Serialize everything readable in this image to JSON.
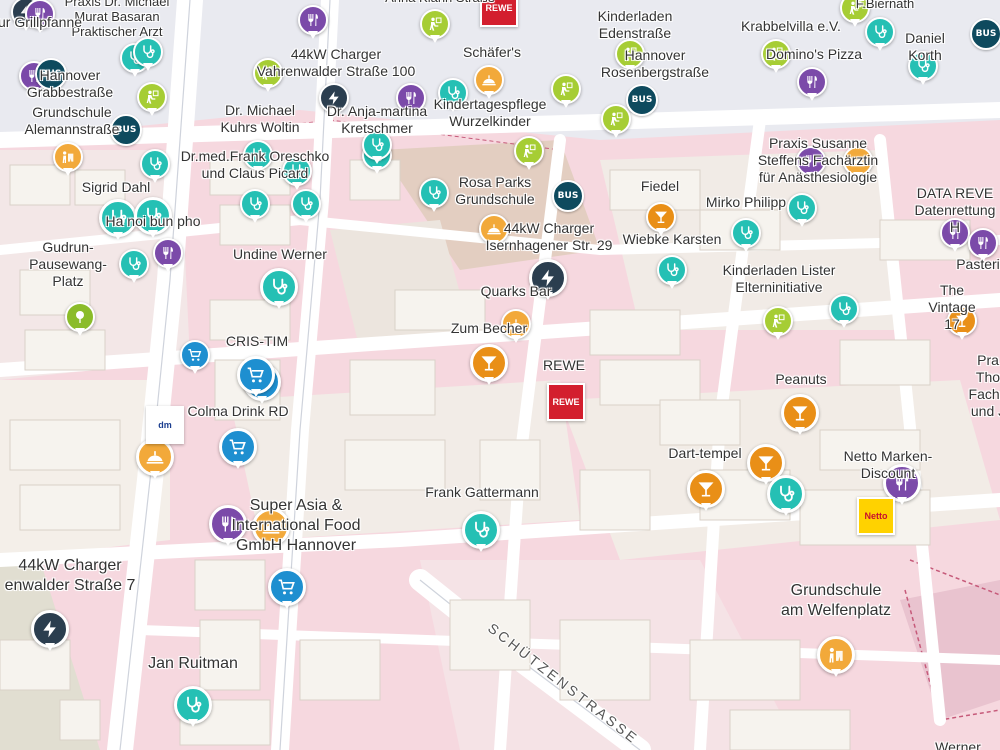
{
  "map": {
    "colors": {
      "health": "#25c0b4",
      "food": "#7b4aa9",
      "bar": "#e98f17",
      "charger": "#2b3e4f",
      "shop": "#1e8fd0",
      "school": "#a6cd34",
      "cafe": "#f2a93a",
      "bus": "#0e4a5e",
      "park": "#8bbc2a",
      "rewe": "#d31f2e",
      "netto": "#ffd200",
      "residential": "#f3c9d2",
      "building": "#f4f1ec"
    },
    "street": "SCHÜTZENSTRASSE",
    "labels": [
      "Praxis Dr. Michael\nMurat Basaran\nPraktischer Arzt",
      "Anna Klann Straße",
      "Kinderladen\nEdenstraße",
      "Krabbelvilla e.V.",
      "F.Biernath",
      "Daniel Korth",
      "ur Grillpfanne",
      "44kW Charger\nVahrenwalder Straße 100",
      "Schäfer's",
      "Hannover\nRosenbergstraße",
      "Domino's Pizza",
      "Hannover\nGrabbestraße",
      "Dr. Michael\nKuhrs Woltin",
      "Dr. Anja-martina\nKretschmer",
      "Kindertagespflege\nWurzelkinder",
      "Grundschule\nAlemannstraße",
      "Praxis Susanne\nSteffens Fachärztin\nfür Anästhesiologie",
      "Dr.med.Frank Oreschko\nund Claus Picard",
      "Rosa Parks\nGrundschule",
      "Fiedel",
      "DATA REVE\nDatenrettung H",
      "Sigrid Dahl",
      "Mirko Philipp",
      "Ha noi bun pho",
      "44kW Charger\nIsernhagener Str. 29",
      "Wiebke Karsten",
      "Pasteri",
      "Gudrun-\nPausewang-\nPlatz",
      "Undine Werner",
      "Kinderladen Lister\nElterninitiative",
      "Quarks Bar",
      "The Vintage 17",
      "Zum Becher",
      "CRIS-TIM",
      "REWE",
      "Pra\nTho\nFacha\nund J",
      "Colma Drink RD",
      "Peanuts",
      "Dart-tempel",
      "Netto Marken-\nDiscount",
      "Frank Gattermann",
      "Super Asia &\nInternational Food\nGmbH Hannover",
      "44kW Charger\nenwalder Straße 7",
      "Grundschule\nam Welfenplatz",
      "Jan Ruitman",
      "Werner w"
    ],
    "bus_label": "BUS",
    "dm_label": "dm",
    "rewe_label": "REWE",
    "netto_label": "Netto"
  }
}
